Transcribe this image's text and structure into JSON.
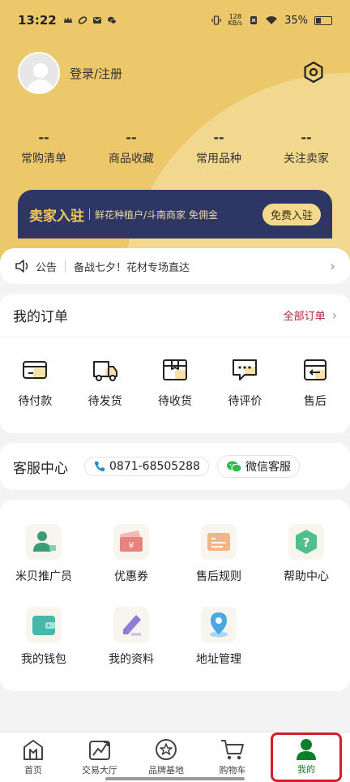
{
  "status_bar": {
    "time": "13:22",
    "net_speed_value": "128",
    "net_speed_unit": "KB/s",
    "battery": "35%",
    "battery_level": 0.35
  },
  "profile": {
    "login_text": "登录/注册"
  },
  "stats": [
    {
      "value": "--",
      "label": "常购清单"
    },
    {
      "value": "--",
      "label": "商品收藏"
    },
    {
      "value": "--",
      "label": "常用品种"
    },
    {
      "value": "--",
      "label": "关注卖家"
    }
  ],
  "seller_banner": {
    "title": "卖家入驻",
    "description": "鲜花种植户/斗南商家 免佣金",
    "button": "免费入驻"
  },
  "notice": {
    "label": "公告",
    "text": "备战七夕！花材专场直达"
  },
  "orders": {
    "title": "我的订单",
    "all_link": "全部订单",
    "items": [
      {
        "label": "待付款",
        "icon": "wallet-icon"
      },
      {
        "label": "待发货",
        "icon": "truck-icon"
      },
      {
        "label": "待收货",
        "icon": "box-icon"
      },
      {
        "label": "待评价",
        "icon": "comment-icon"
      },
      {
        "label": "售后",
        "icon": "return-icon"
      }
    ]
  },
  "service": {
    "title": "客服中心",
    "phone": "0871-68505288",
    "wechat": "微信客服"
  },
  "tools": [
    {
      "label": "米贝推广员",
      "icon": "promoter-icon",
      "color": "#3b9c76"
    },
    {
      "label": "优惠券",
      "icon": "coupon-icon",
      "color": "#e8827c"
    },
    {
      "label": "售后规则",
      "icon": "rules-icon",
      "color": "#f0a971"
    },
    {
      "label": "帮助中心",
      "icon": "help-icon",
      "color": "#4fbf8c"
    },
    {
      "label": "我的钱包",
      "icon": "wallet-icon",
      "color": "#46b7a8"
    },
    {
      "label": "我的资料",
      "icon": "profile-edit-icon",
      "color": "#8b7fd6"
    },
    {
      "label": "地址管理",
      "icon": "location-icon",
      "color": "#4aa7e0"
    }
  ],
  "tabbar": [
    {
      "label": "首页",
      "icon": "home-icon"
    },
    {
      "label": "交易大厅",
      "icon": "trade-chart-icon"
    },
    {
      "label": "品牌基地",
      "icon": "brand-icon"
    },
    {
      "label": "购物车",
      "icon": "cart-icon"
    },
    {
      "label": "我的",
      "icon": "user-icon",
      "active": true
    }
  ],
  "colors": {
    "header_yellow": "#ecc86a",
    "seller_navy": "#2e3763",
    "accent_red": "#b22234",
    "active_green": "#0d7e2a"
  }
}
